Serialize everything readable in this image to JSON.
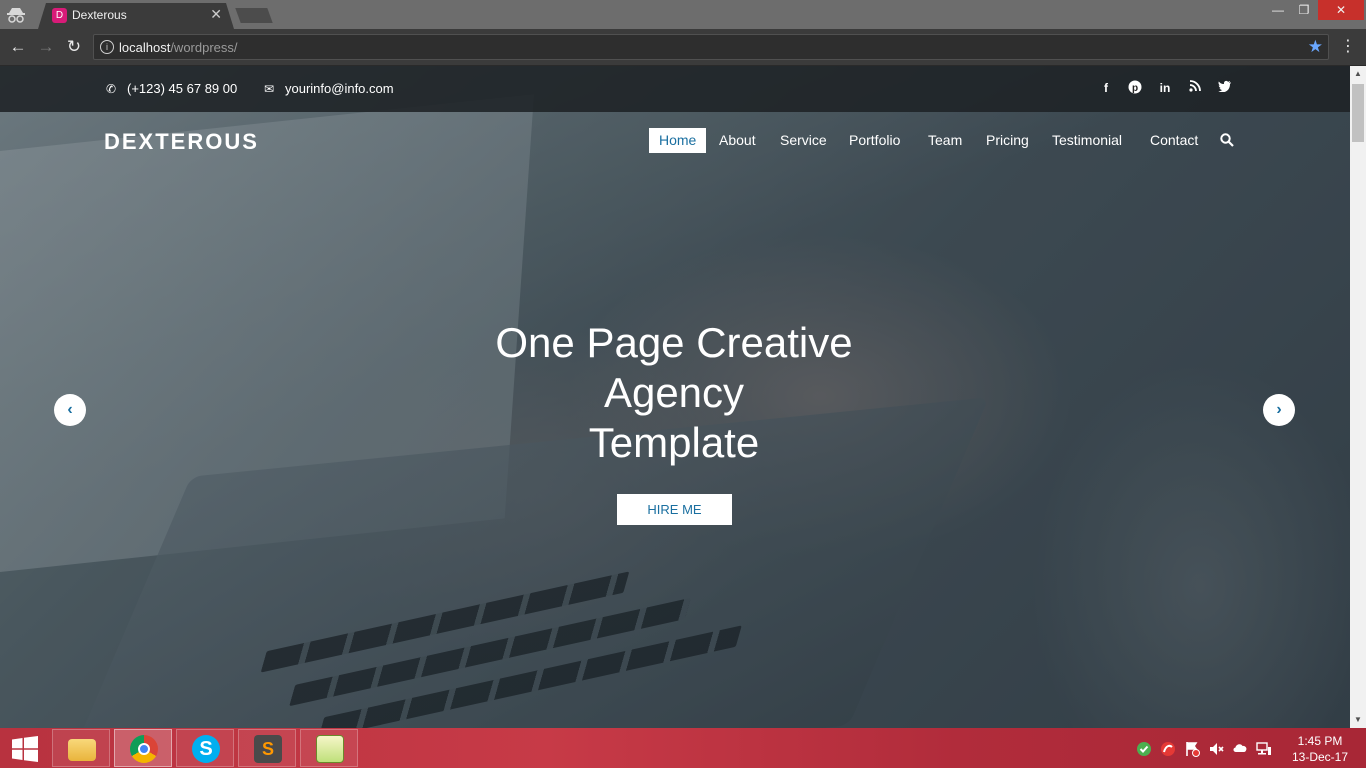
{
  "browser": {
    "tab_title": "Dexterous",
    "tab_favicon_letter": "D",
    "url_host": "localhost",
    "url_path": "/wordpress/"
  },
  "site": {
    "topbar": {
      "phone": "(+123) 45 67 89 00",
      "email": "yourinfo@info.com",
      "social_icons": [
        "facebook-icon",
        "pinterest-icon",
        "linkedin-icon",
        "rss-icon",
        "twitter-icon"
      ]
    },
    "brand": "DEXTEROUS",
    "menu": [
      "Home",
      "About",
      "Service",
      "Portfolio",
      "Team",
      "Pricing",
      "Testimonial",
      "Contact"
    ],
    "active_menu": "Home",
    "hero": {
      "title_lines": [
        "One Page Creative",
        "Agency",
        "Template"
      ],
      "cta": "HIRE ME"
    }
  },
  "taskbar": {
    "apps": [
      "file-explorer",
      "google-chrome",
      "skype",
      "sublime-text",
      "notepad-plus-plus"
    ],
    "active_app": "google-chrome",
    "clock_time": "1:45 PM",
    "clock_date": "13-Dec-17"
  },
  "colors": {
    "accent": "#1a6fa0",
    "taskbar": "#c73a47",
    "close_button": "#c7302b"
  }
}
